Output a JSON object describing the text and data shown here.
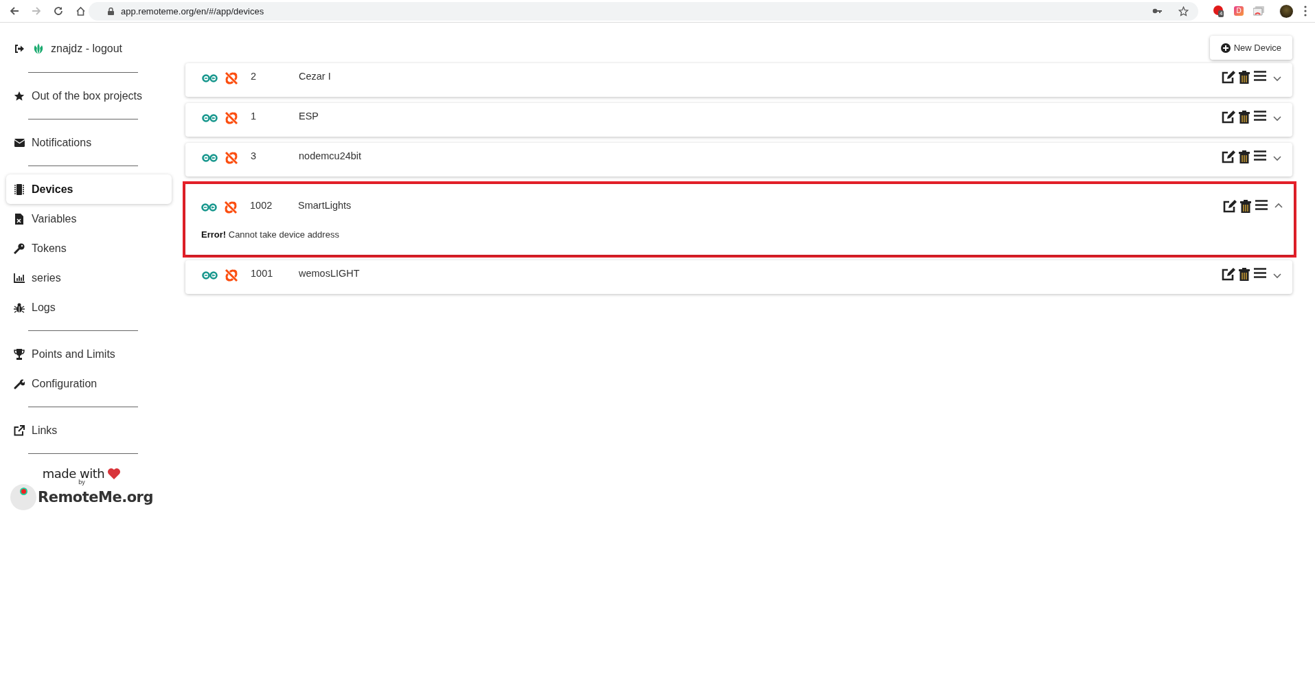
{
  "browser": {
    "url": "app.remoteme.org/en/#/app/devices",
    "forward_disabled": true,
    "extensions": [
      {
        "kind": "badge",
        "text": "4"
      },
      {
        "kind": "letter",
        "text": "D"
      },
      {
        "kind": "cast"
      }
    ]
  },
  "sidebar": {
    "user": "znajdz - logout",
    "groups": [
      [
        {
          "label": "Out of the box projects",
          "selected": false
        }
      ],
      [
        {
          "label": "Notifications",
          "selected": false
        }
      ],
      [
        {
          "label": "Devices",
          "selected": true
        },
        {
          "label": "Variables",
          "selected": false
        },
        {
          "label": "Tokens",
          "selected": false
        },
        {
          "label": "series",
          "selected": false
        },
        {
          "label": "Logs",
          "selected": false
        }
      ],
      [
        {
          "label": "Points and Limits",
          "selected": false
        },
        {
          "label": "Configuration",
          "selected": false
        }
      ],
      [
        {
          "label": "Links",
          "selected": false
        }
      ]
    ],
    "footer": {
      "made_with": "made with",
      "by": "by",
      "brand": "RemoteMe.org"
    }
  },
  "new_device_button": "New Device",
  "devices": [
    {
      "id": "2",
      "name": "Cezar I",
      "expanded": false,
      "highlighted": false
    },
    {
      "id": "1",
      "name": "ESP",
      "expanded": false,
      "highlighted": false
    },
    {
      "id": "3",
      "name": "nodemcu24bit",
      "expanded": false,
      "highlighted": false
    },
    {
      "id": "1002",
      "name": "SmartLights",
      "expanded": true,
      "highlighted": true,
      "error": "**Error!** Cannot take device address"
    },
    {
      "id": "1001",
      "name": "wemosLIGHT",
      "expanded": false,
      "highlighted": false
    }
  ]
}
